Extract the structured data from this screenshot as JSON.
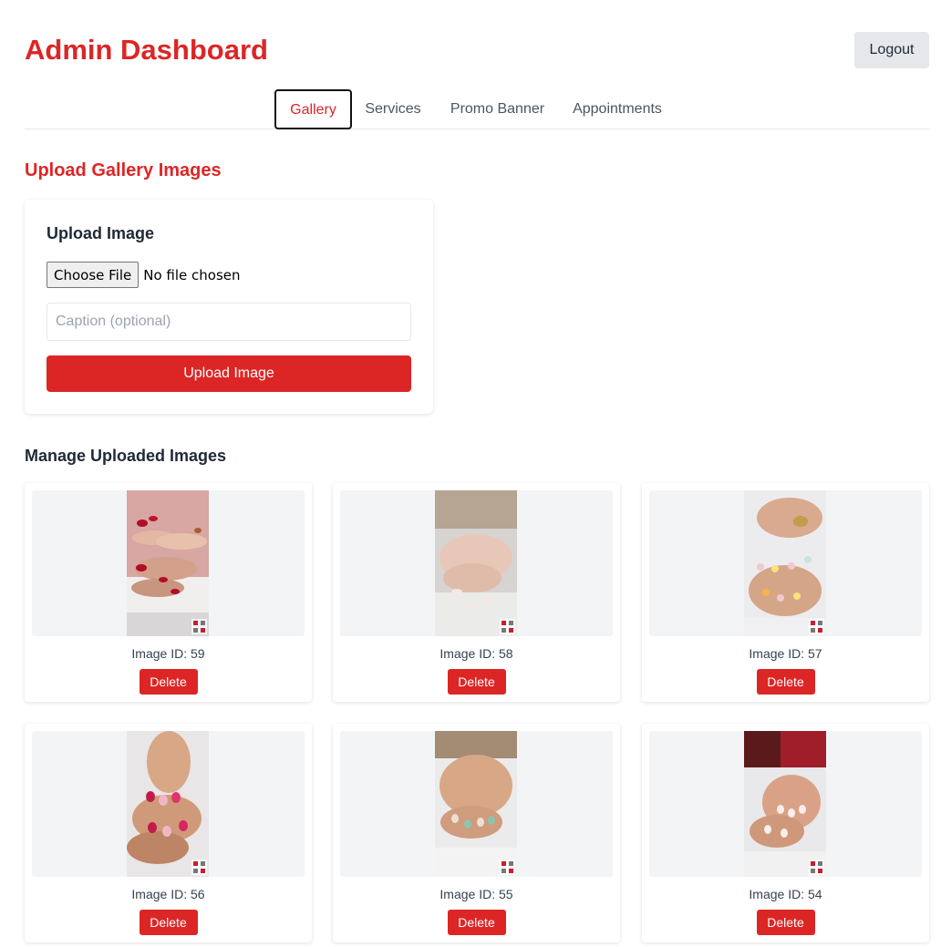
{
  "header": {
    "title": "Admin Dashboard",
    "logout_label": "Logout"
  },
  "tabs": [
    {
      "label": "Gallery",
      "active": true
    },
    {
      "label": "Services",
      "active": false
    },
    {
      "label": "Promo Banner",
      "active": false
    },
    {
      "label": "Appointments",
      "active": false
    }
  ],
  "upload": {
    "section_title": "Upload Gallery Images",
    "card_title": "Upload Image",
    "choose_file_label": "Choose File",
    "file_status": "No file chosen",
    "caption_placeholder": "Caption (optional)",
    "caption_value": "",
    "upload_button": "Upload Image"
  },
  "manage": {
    "title": "Manage Uploaded Images",
    "images": [
      {
        "id_label": "Image ID: 59",
        "delete_label": "Delete"
      },
      {
        "id_label": "Image ID: 58",
        "delete_label": "Delete"
      },
      {
        "id_label": "Image ID: 57",
        "delete_label": "Delete"
      },
      {
        "id_label": "Image ID: 56",
        "delete_label": "Delete"
      },
      {
        "id_label": "Image ID: 55",
        "delete_label": "Delete"
      },
      {
        "id_label": "Image ID: 54",
        "delete_label": "Delete"
      }
    ]
  },
  "colors": {
    "accent": "#dc2626",
    "tab_border": "#111111",
    "thumb_bg": "#f3f4f6"
  }
}
